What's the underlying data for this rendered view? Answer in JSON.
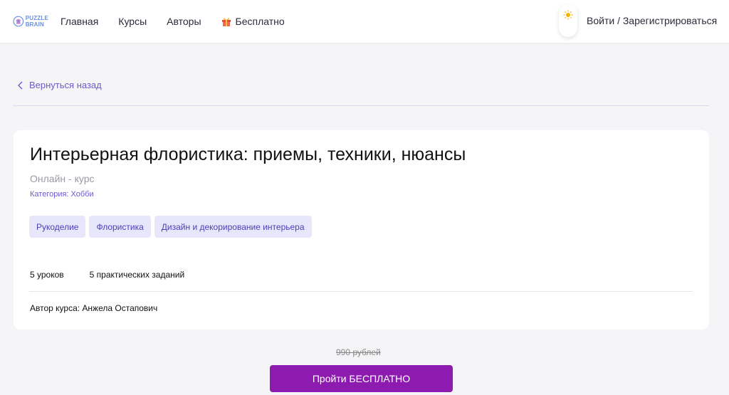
{
  "header": {
    "logo": {
      "line1": "PUZZLE",
      "line2": "BRAIN"
    },
    "nav": [
      "Главная",
      "Курсы",
      "Авторы",
      "Бесплатно"
    ],
    "login": "Войти / Зарегистрироваться",
    "icons": {
      "gift": "gift-icon",
      "theme": "sun-icon"
    }
  },
  "back": {
    "label": "Вернуться назад",
    "icon": "chevron-left-icon"
  },
  "course": {
    "title": "Интерьерная флористика: приемы, техники, нюансы",
    "format": "Онлайн - курс",
    "category": "Категория: Хобби",
    "tags": [
      "Рукоделие",
      "Флористика",
      "Дизайн и декорирование интерьера"
    ],
    "lessons": "5 уроков",
    "tasks": "5 практических заданий",
    "author": "Автор курса: Анжела Остапович"
  },
  "pricing": {
    "old_price": "990 рублей",
    "cta": "Пройти БЕСПЛАТНО"
  },
  "colors": {
    "accent": "#6a5acd",
    "cta": "#8e1bb0",
    "tag_bg": "#e8e6fb"
  }
}
